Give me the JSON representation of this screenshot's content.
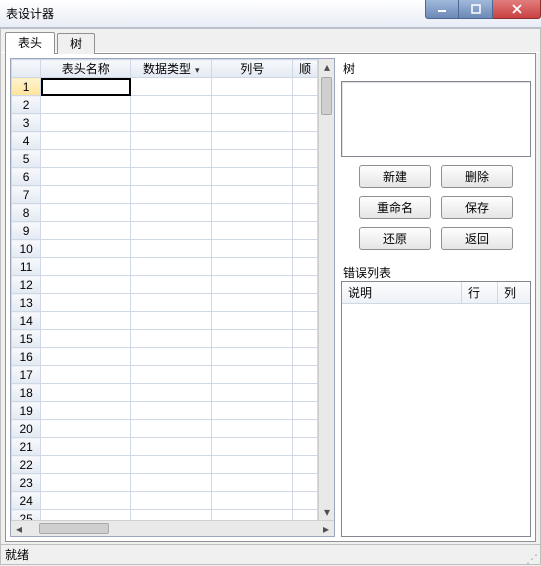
{
  "window": {
    "title": "表设计器"
  },
  "tabs": [
    {
      "label": "表头",
      "active": true
    },
    {
      "label": "树",
      "active": false
    }
  ],
  "grid": {
    "headers": {
      "rownum": "",
      "name": "表头名称",
      "datatype": "数据类型",
      "colno": "列号",
      "last": "顺"
    },
    "row_count": 26,
    "selected_row": 1
  },
  "right": {
    "tree_label": "树",
    "buttons": {
      "new": "新建",
      "delete": "删除",
      "rename": "重命名",
      "save": "保存",
      "restore": "还原",
      "back": "返回"
    },
    "error_label": "错误列表",
    "error_columns": {
      "desc": "说明",
      "row": "行",
      "col": "列"
    }
  },
  "status": {
    "text": "就绪"
  }
}
